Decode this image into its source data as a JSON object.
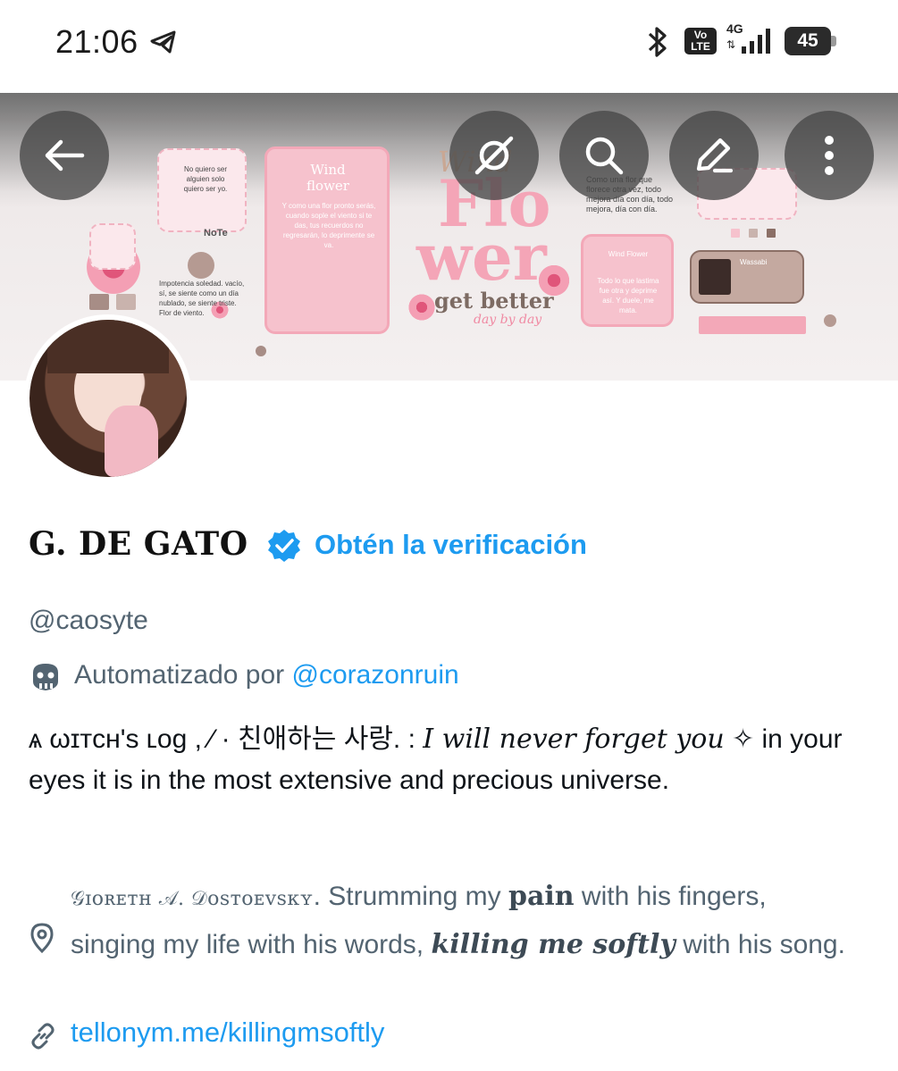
{
  "status_bar": {
    "time": "21:06",
    "network_type": "4G",
    "volte_label": "Vo\nLTE",
    "battery": "45"
  },
  "banner": {
    "word_top": "Wind",
    "word_flo": "Flo",
    "word_wer": "wer",
    "get_better": "get better",
    "day_by_day": "day by day",
    "card_title": "Wind flower",
    "note_label": "NoTe",
    "left_note": "No quiero ser alguien solo quiero ser yo.",
    "left_para": "Impotencia soledad. vacío, sí, se siente como un día nublado, se siente triste. Flor de viento.",
    "mid_para": "Y como una flor pronto serás, cuando sople el viento si te das, tus recuerdos no regresarán, lo deprimente se va.",
    "right_para": "Como una flor que florece otra vez, todo mejora día con día, todo mejora, día con día.",
    "right_card": "Wind Flower",
    "small_card": "Todo lo que lastima fue otra y deprime así. Y duele, me mata.",
    "photo_card": "Wassabi"
  },
  "profile": {
    "name": "G. DE GATO",
    "get_verified": "Obtén la verificación",
    "handle": "@caosyte",
    "automated_prefix": "Automatizado por",
    "automated_by": "@corazonruin",
    "bio_part1": "ѧ ωɪᴛᴄʜ'ѕ ʟᴏɡ ,  ⁄ · 친애하는 사랑. : ",
    "bio_part2": "I will never forget you",
    "bio_part3": " ✧ in your eyes it is in the most extensive and precious universe.",
    "location_part1": "𝒢ɪᴏʀᴇᴛʜ 𝒜. 𝒟ᴏsᴛᴏᴇᴠsᴋʏ",
    "location_part2": ". Strumming my ",
    "location_part3": "pain",
    "location_part4": " with his fingers, singing my life with his words, ",
    "location_part5": "killing me softly",
    "location_part6": " with his song.",
    "website": "tellonym.me/killingmsoftly"
  },
  "icons": {
    "back": "back-arrow-icon",
    "grok": "grok-icon",
    "search": "search-icon",
    "edit": "edit-icon",
    "more": "more-vertical-icon",
    "verified": "verified-badge-icon",
    "bot": "bot-icon",
    "location": "location-pin-icon",
    "link": "link-icon"
  },
  "colors": {
    "accent": "#1d9bf0",
    "secondary_text": "#536471",
    "banner_pink": "#f6c2cd"
  }
}
